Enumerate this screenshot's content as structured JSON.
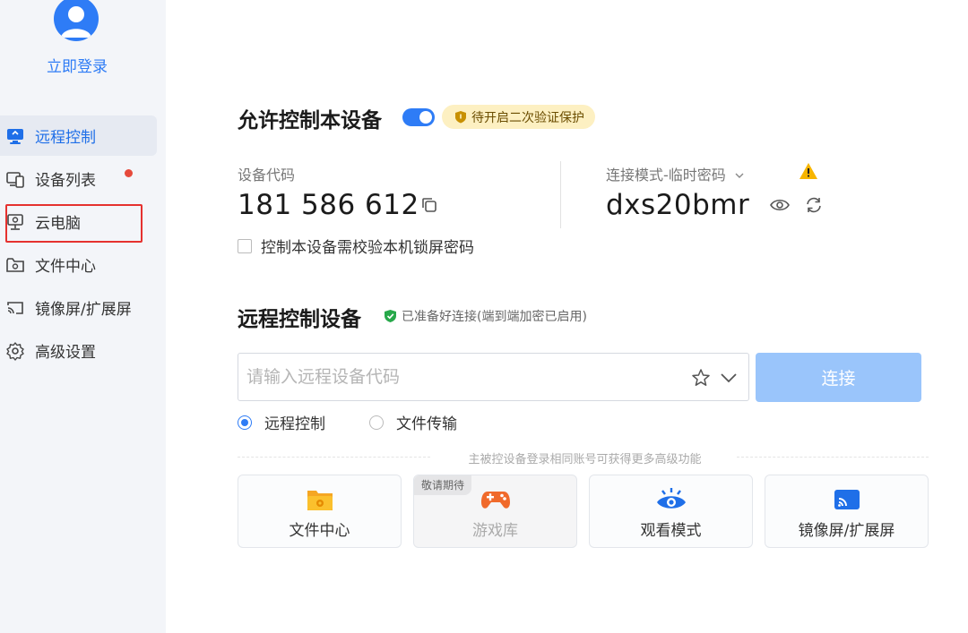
{
  "sidebar": {
    "login_label": "立即登录",
    "items": [
      {
        "label": "远程控制",
        "icon": "monitor-icon",
        "active": true
      },
      {
        "label": "设备列表",
        "icon": "devices-icon",
        "badge": true
      },
      {
        "label": "云电脑",
        "icon": "cloud-pc-icon"
      },
      {
        "label": "文件中心",
        "icon": "folder-icon"
      },
      {
        "label": "镜像屏/扩展屏",
        "icon": "cast-icon"
      },
      {
        "label": "高级设置",
        "icon": "gear-icon"
      }
    ]
  },
  "allow": {
    "title": "允许控制本设备",
    "toggle_on": true,
    "badge_label": "待开启二次验证保护",
    "device_code_label": "设备代码",
    "device_code": "181 586 612",
    "mode_label": "连接模式-临时密码",
    "password": "dxs20bmr",
    "lock_checkbox_label": "控制本设备需校验本机锁屏密码"
  },
  "remote": {
    "title": "远程控制设备",
    "ready_note": "已准备好连接(端到端加密已启用)",
    "input_placeholder": "请输入远程设备代码",
    "connect_label": "连接",
    "radio_remote": "远程控制",
    "radio_file": "文件传输",
    "hint": "主被控设备登录相同账号可获得更多高级功能"
  },
  "cards": [
    {
      "label": "文件中心",
      "icon": "file-center-icon"
    },
    {
      "label": "游戏库",
      "icon": "gamepad-icon",
      "tag": "敬请期待",
      "disabled": true
    },
    {
      "label": "观看模式",
      "icon": "eye-icon"
    },
    {
      "label": "镜像屏/扩展屏",
      "icon": "screen-cast-icon"
    }
  ],
  "colors": {
    "accent": "#2e7cf6",
    "sidebar_bg": "#f3f5f9",
    "connect_btn": "#9ac5fb",
    "badge_bg": "#fdf0c2",
    "highlight_red": "#e5312f"
  }
}
